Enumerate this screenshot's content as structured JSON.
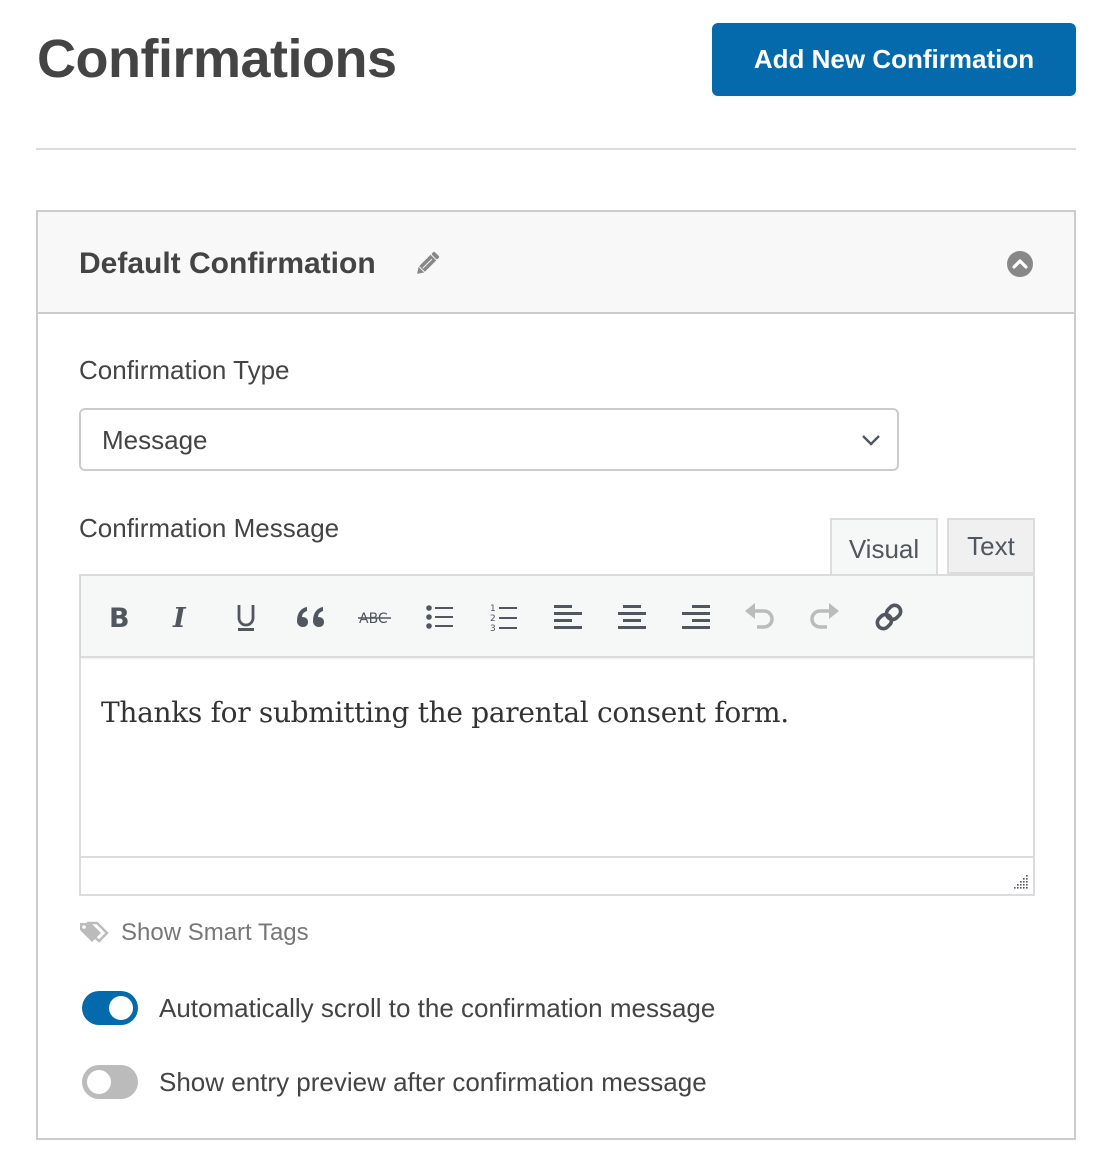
{
  "header": {
    "title": "Confirmations",
    "add_button_label": "Add New Confirmation"
  },
  "colors": {
    "primary": "#056aab",
    "toggle_off": "#bbbbbb",
    "border": "#cccccc"
  },
  "panel": {
    "title": "Default Confirmation",
    "edit_icon": "pencil-icon",
    "collapse_icon": "chevron-up-circle-icon",
    "confirmation_type": {
      "label": "Confirmation Type",
      "selected": "Message"
    },
    "confirmation_message": {
      "label": "Confirmation Message",
      "tabs": [
        {
          "label": "Visual",
          "active": true
        },
        {
          "label": "Text",
          "active": false
        }
      ],
      "toolbar": [
        {
          "name": "bold",
          "icon": "bold-icon"
        },
        {
          "name": "italic",
          "icon": "italic-icon"
        },
        {
          "name": "underline",
          "icon": "underline-icon"
        },
        {
          "name": "blockquote",
          "icon": "quote-icon"
        },
        {
          "name": "strikethrough",
          "icon": "strikethrough-icon"
        },
        {
          "name": "bulleted-list",
          "icon": "bulleted-list-icon"
        },
        {
          "name": "numbered-list",
          "icon": "numbered-list-icon"
        },
        {
          "name": "align-left",
          "icon": "align-left-icon"
        },
        {
          "name": "align-center",
          "icon": "align-center-icon"
        },
        {
          "name": "align-right",
          "icon": "align-right-icon"
        },
        {
          "name": "undo",
          "icon": "undo-icon",
          "disabled": true
        },
        {
          "name": "redo",
          "icon": "redo-icon",
          "disabled": true
        },
        {
          "name": "insert-link",
          "icon": "link-icon"
        }
      ],
      "content": "Thanks for submitting the parental consent form."
    },
    "smart_tags_label": "Show Smart Tags",
    "toggles": [
      {
        "label": "Automatically scroll to the confirmation message",
        "on": true
      },
      {
        "label": "Show entry preview after confirmation message",
        "on": false
      }
    ]
  }
}
